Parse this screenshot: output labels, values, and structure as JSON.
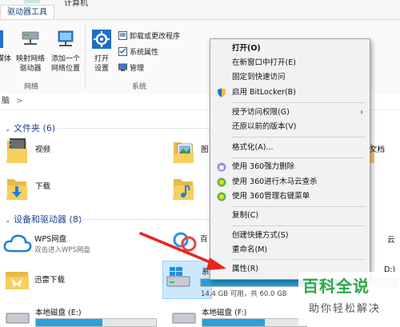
{
  "ribbon": {
    "tab_drive_tools": "驱动器工具",
    "tab_computer": "计算机",
    "buttons": {
      "media": "媒体",
      "map_drive_line1": "映射网络",
      "map_drive_line2": "驱动器",
      "add_location_line1": "添加一个",
      "add_location_line2": "网络位置",
      "open_settings_line1": "打开",
      "open_settings_line2": "设置",
      "uninstall": "卸载或更改程序",
      "system_props": "系统属性",
      "manage": "管理"
    },
    "groups": {
      "network": "网络",
      "system": "系统"
    }
  },
  "address": {
    "text": "脑",
    "sep": ">"
  },
  "folders": {
    "header": "文件夹 (6)",
    "items": [
      "视频",
      "下载",
      "图",
      "文档"
    ]
  },
  "devices": {
    "header": "设备和驱动器 (8)",
    "wps": {
      "name": "WPS网盘",
      "sub": "双击进入WPS网盘"
    },
    "xunlei": {
      "name": "迅雷下载"
    },
    "baidu_partial": "百",
    "right_partial_1": "云",
    "right_partial_2": "D:)",
    "system_drive": {
      "name": "系",
      "free": "14.4 GB 可用，共 60.0 GB",
      "fill_fraction": 0.76
    },
    "drive_e": {
      "name": "本地磁盘 (E:)"
    },
    "drive_f": {
      "name": "本地磁盘 (F:)"
    }
  },
  "context_menu": {
    "items": [
      {
        "label": "打开(O)",
        "bold": true
      },
      {
        "label": "在新窗口中打开(E)"
      },
      {
        "label": "固定到快速访问"
      },
      {
        "label": "启用 BitLocker(B)",
        "icon": "shield-icon"
      },
      {
        "label": "授予访问权限(G)",
        "submenu": true
      },
      {
        "label": "还原以前的版本(V)"
      },
      {
        "label": "格式化(A)..."
      },
      {
        "label": "使用 360强力删除",
        "icon": "360-delete-icon"
      },
      {
        "label": "使用 360进行木马云查杀",
        "icon": "360-scan-icon"
      },
      {
        "label": "使用 360管理右键菜单",
        "icon": "360-manage-icon"
      },
      {
        "label": "复制(C)"
      },
      {
        "label": "创建快捷方式(S)"
      },
      {
        "label": "重命名(M)"
      },
      {
        "label": "属性(R)"
      }
    ],
    "submenu_arrow": "›"
  },
  "watermark": {
    "title": "百科全说",
    "subtitle": "助你轻松解决"
  },
  "colors": {
    "accent": "#26a0da",
    "arrow": "#e8231f",
    "watermark_green": "#2aa846"
  }
}
